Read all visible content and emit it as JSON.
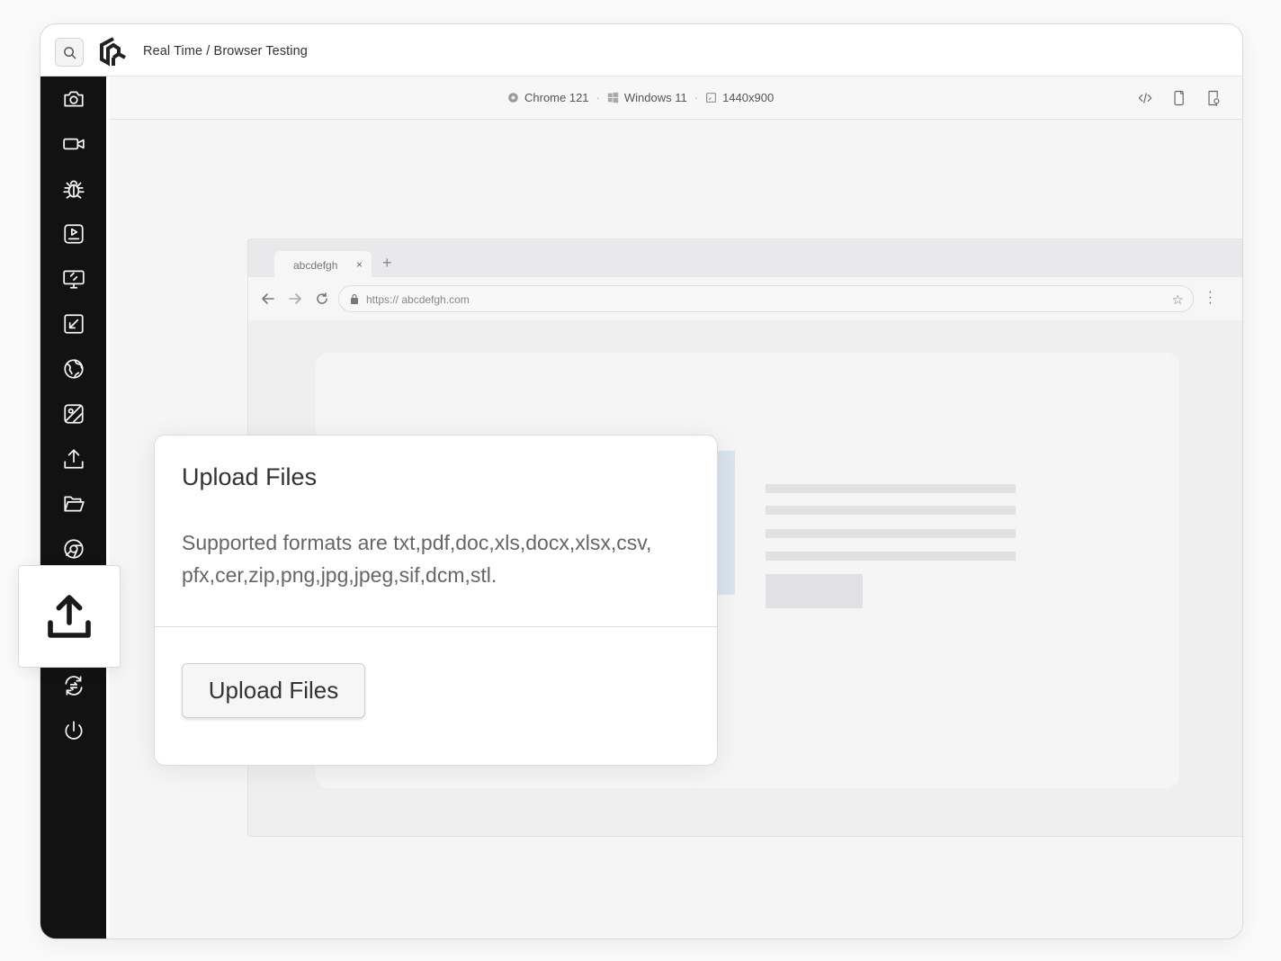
{
  "header": {
    "title": "Real Time / Browser Testing"
  },
  "sidebar": {
    "items": [
      {
        "icon": "camera-icon"
      },
      {
        "icon": "video-icon"
      },
      {
        "icon": "bug-icon"
      },
      {
        "icon": "recording-icon"
      },
      {
        "icon": "screen-resolution-icon"
      },
      {
        "icon": "resize-icon"
      },
      {
        "icon": "globe-icon"
      },
      {
        "icon": "image-icon"
      },
      {
        "icon": "upload-icon"
      },
      {
        "icon": "folder-icon"
      },
      {
        "icon": "chrome-icon"
      },
      {
        "icon": "switch-icon"
      },
      {
        "icon": "power-icon"
      }
    ]
  },
  "environment": {
    "browser": "Chrome 121",
    "os": "Windows 11",
    "resolution": "1440x900",
    "separator": "·"
  },
  "browser_mock": {
    "tab_label": "abcdefgh",
    "tab_close": "×",
    "new_tab": "+",
    "url": "https:// abcdefgh.com"
  },
  "upload_dialog": {
    "title": "Upload Files",
    "description": "Supported formats are txt,pdf,doc,xls,docx,xlsx,csv, pfx,cer,zip,png,jpg,jpeg,sif,dcm,stl.",
    "button_label": "Upload Files"
  },
  "colors": {
    "sidebar_bg": "#121212",
    "content_bg": "#f5f5f5",
    "placeholder_image": "#d9e4ee"
  }
}
